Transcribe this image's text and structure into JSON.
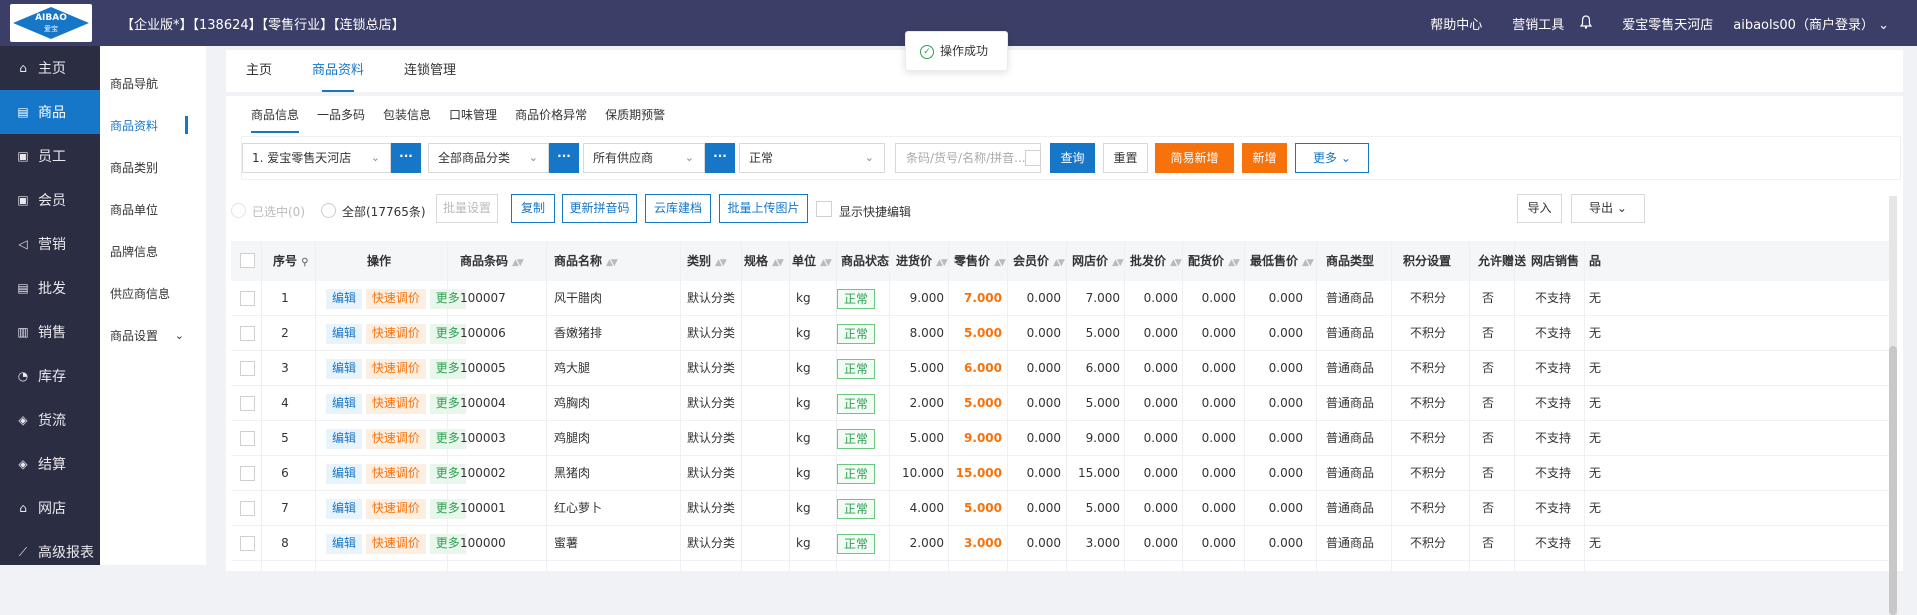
{
  "brand": {
    "logo_text": "AIBAO",
    "logo_sub": "爱宝"
  },
  "header": {
    "title": "【企业版*】【138624】【零售行业】【连锁总店】",
    "help": "帮助中心",
    "marketing": "营销工具",
    "store": "爱宝零售天河店",
    "user": "aibaols00（商户登录）"
  },
  "toast": {
    "message": "操作成功"
  },
  "sidebar": {
    "items": [
      {
        "label": "主页",
        "icon": "home-icon"
      },
      {
        "label": "商品",
        "icon": "product-icon"
      },
      {
        "label": "员工",
        "icon": "staff-icon"
      },
      {
        "label": "会员",
        "icon": "member-icon"
      },
      {
        "label": "营销",
        "icon": "megaphone-icon"
      },
      {
        "label": "批发",
        "icon": "wholesale-icon"
      },
      {
        "label": "销售",
        "icon": "chart-icon"
      },
      {
        "label": "库存",
        "icon": "inventory-icon"
      },
      {
        "label": "货流",
        "icon": "flow-icon"
      },
      {
        "label": "结算",
        "icon": "settle-icon"
      },
      {
        "label": "网店",
        "icon": "shop-icon"
      },
      {
        "label": "高级报表",
        "icon": "report-icon"
      }
    ]
  },
  "subnav": {
    "items": [
      "商品导航",
      "商品资料",
      "商品类别",
      "商品单位",
      "品牌信息",
      "供应商信息",
      "商品设置"
    ]
  },
  "tabs": [
    "主页",
    "商品资料",
    "连锁管理"
  ],
  "subtabs": [
    "商品信息",
    "一品多码",
    "包装信息",
    "口味管理",
    "商品价格异常",
    "保质期预警"
  ],
  "filters": {
    "store": "1. 爱宝零售天河店",
    "category": "全部商品分类",
    "supplier": "所有供应商",
    "status": "正常",
    "search_placeholder": "条码/货号/名称/拼音...",
    "dots": "···",
    "query": "查询",
    "reset": "重置",
    "quick_add": "简易新增",
    "add": "新增",
    "more": "更多"
  },
  "toolbar": {
    "selected": "已选中(0)",
    "all": "全部(17765条)",
    "batch_set": "批量设置",
    "copy": "复制",
    "update_pinyin": "更新拼音码",
    "cloud_build": "云库建档",
    "batch_upload": "批量上传图片",
    "quick_edit": "显示快捷编辑",
    "import": "导入",
    "export": "导出"
  },
  "table": {
    "headers": [
      "序号",
      "操作",
      "商品条码",
      "商品名称",
      "类别",
      "规格",
      "单位",
      "商品状态",
      "进货价",
      "零售价",
      "会员价",
      "网店价",
      "批发价",
      "配货价",
      "最低售价",
      "商品类型",
      "积分设置",
      "允许赠送",
      "网店销售",
      "品"
    ],
    "actions": {
      "edit": "编辑",
      "adjust": "快速调价",
      "more": "更多"
    },
    "rows": [
      {
        "no": "1",
        "code": "100007",
        "name": "风干腊肉",
        "cat": "默认分类",
        "spec": "",
        "unit": "kg",
        "status": "正常",
        "buy": "9.000",
        "retail": "7.000",
        "member": "0.000",
        "online": "7.000",
        "wholesale": "0.000",
        "dist": "0.000",
        "min": "0.000",
        "type": "普通商品",
        "points": "不积分",
        "gift": "否",
        "online_sale": "不支持",
        "brand": "无"
      },
      {
        "no": "2",
        "code": "100006",
        "name": "香嫩猪排",
        "cat": "默认分类",
        "spec": "",
        "unit": "kg",
        "status": "正常",
        "buy": "8.000",
        "retail": "5.000",
        "member": "0.000",
        "online": "5.000",
        "wholesale": "0.000",
        "dist": "0.000",
        "min": "0.000",
        "type": "普通商品",
        "points": "不积分",
        "gift": "否",
        "online_sale": "不支持",
        "brand": "无"
      },
      {
        "no": "3",
        "code": "100005",
        "name": "鸡大腿",
        "cat": "默认分类",
        "spec": "",
        "unit": "kg",
        "status": "正常",
        "buy": "5.000",
        "retail": "6.000",
        "member": "0.000",
        "online": "6.000",
        "wholesale": "0.000",
        "dist": "0.000",
        "min": "0.000",
        "type": "普通商品",
        "points": "不积分",
        "gift": "否",
        "online_sale": "不支持",
        "brand": "无"
      },
      {
        "no": "4",
        "code": "100004",
        "name": "鸡胸肉",
        "cat": "默认分类",
        "spec": "",
        "unit": "kg",
        "status": "正常",
        "buy": "2.000",
        "retail": "5.000",
        "member": "0.000",
        "online": "5.000",
        "wholesale": "0.000",
        "dist": "0.000",
        "min": "0.000",
        "type": "普通商品",
        "points": "不积分",
        "gift": "否",
        "online_sale": "不支持",
        "brand": "无"
      },
      {
        "no": "5",
        "code": "100003",
        "name": "鸡腿肉",
        "cat": "默认分类",
        "spec": "",
        "unit": "kg",
        "status": "正常",
        "buy": "5.000",
        "retail": "9.000",
        "member": "0.000",
        "online": "9.000",
        "wholesale": "0.000",
        "dist": "0.000",
        "min": "0.000",
        "type": "普通商品",
        "points": "不积分",
        "gift": "否",
        "online_sale": "不支持",
        "brand": "无"
      },
      {
        "no": "6",
        "code": "100002",
        "name": "黑猪肉",
        "cat": "默认分类",
        "spec": "",
        "unit": "kg",
        "status": "正常",
        "buy": "10.000",
        "retail": "15.000",
        "member": "0.000",
        "online": "15.000",
        "wholesale": "0.000",
        "dist": "0.000",
        "min": "0.000",
        "type": "普通商品",
        "points": "不积分",
        "gift": "否",
        "online_sale": "不支持",
        "brand": "无"
      },
      {
        "no": "7",
        "code": "100001",
        "name": "红心萝卜",
        "cat": "默认分类",
        "spec": "",
        "unit": "kg",
        "status": "正常",
        "buy": "4.000",
        "retail": "5.000",
        "member": "0.000",
        "online": "5.000",
        "wholesale": "0.000",
        "dist": "0.000",
        "min": "0.000",
        "type": "普通商品",
        "points": "不积分",
        "gift": "否",
        "online_sale": "不支持",
        "brand": "无"
      },
      {
        "no": "8",
        "code": "100000",
        "name": "蜜薯",
        "cat": "默认分类",
        "spec": "",
        "unit": "kg",
        "status": "正常",
        "buy": "2.000",
        "retail": "3.000",
        "member": "0.000",
        "online": "3.000",
        "wholesale": "0.000",
        "dist": "0.000",
        "min": "0.000",
        "type": "普通商品",
        "points": "不积分",
        "gift": "否",
        "online_sale": "不支持",
        "brand": "无"
      }
    ]
  },
  "colors": {
    "primary": "#1677c9",
    "orange": "#f7720a",
    "green": "#2ea152",
    "topbar": "#3b3e66",
    "sidebar": "#2b2d42"
  }
}
